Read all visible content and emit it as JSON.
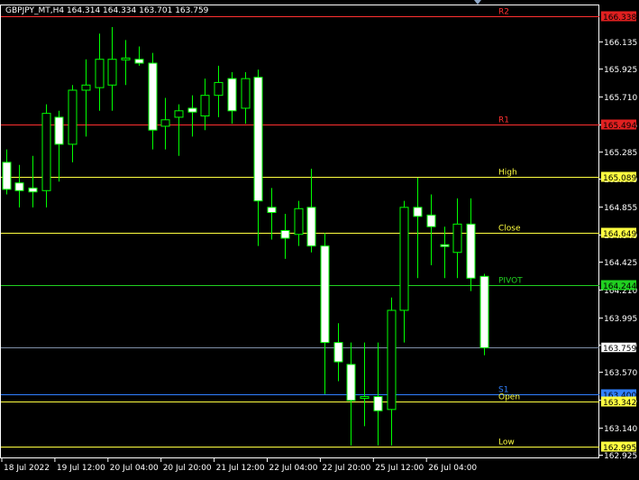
{
  "window": {
    "title": "GBPJPY_MT,H4",
    "ohlc": "164.314 164.334 163.701 163.759"
  },
  "chart_data": {
    "type": "candlestick",
    "symbol": "GBPJPY_MT",
    "timeframe": "H4",
    "y_range": [
      162.9,
      166.4
    ],
    "y_ticks": [
      "166.135",
      "165.925",
      "165.710",
      "165.495",
      "165.285",
      "165.070",
      "164.855",
      "164.640",
      "164.425",
      "164.210",
      "163.995",
      "163.780",
      "163.570",
      "163.355",
      "163.140",
      "162.925"
    ],
    "x_labels": [
      "18 Jul 2022",
      "19 Jul 12:00",
      "20 Jul 04:00",
      "20 Jul 20:00",
      "21 Jul 12:00",
      "22 Jul 04:00",
      "22 Jul 20:00",
      "25 Jul 12:00",
      "26 Jul 04:00"
    ],
    "candles": [
      {
        "o": 165.2,
        "h": 165.3,
        "l": 164.95,
        "c": 164.99
      },
      {
        "o": 165.04,
        "h": 165.18,
        "l": 164.85,
        "c": 164.98
      },
      {
        "o": 165.0,
        "h": 165.25,
        "l": 164.85,
        "c": 164.97
      },
      {
        "o": 164.98,
        "h": 165.65,
        "l": 164.85,
        "c": 165.58
      },
      {
        "o": 165.55,
        "h": 165.6,
        "l": 165.05,
        "c": 165.34
      },
      {
        "o": 165.34,
        "h": 165.8,
        "l": 165.2,
        "c": 165.76
      },
      {
        "o": 165.76,
        "h": 166.0,
        "l": 165.4,
        "c": 165.8
      },
      {
        "o": 165.78,
        "h": 166.2,
        "l": 165.6,
        "c": 166.0
      },
      {
        "o": 165.8,
        "h": 166.25,
        "l": 165.6,
        "c": 166.0
      },
      {
        "o": 166.0,
        "h": 166.15,
        "l": 165.8,
        "c": 166.01
      },
      {
        "o": 166.0,
        "h": 166.1,
        "l": 165.95,
        "c": 165.97
      },
      {
        "o": 165.97,
        "h": 166.05,
        "l": 165.3,
        "c": 165.45
      },
      {
        "o": 165.48,
        "h": 165.7,
        "l": 165.3,
        "c": 165.53
      },
      {
        "o": 165.55,
        "h": 165.65,
        "l": 165.25,
        "c": 165.6
      },
      {
        "o": 165.62,
        "h": 165.72,
        "l": 165.4,
        "c": 165.59
      },
      {
        "o": 165.56,
        "h": 165.85,
        "l": 165.45,
        "c": 165.72
      },
      {
        "o": 165.72,
        "h": 165.95,
        "l": 165.55,
        "c": 165.82
      },
      {
        "o": 165.85,
        "h": 165.9,
        "l": 165.5,
        "c": 165.6
      },
      {
        "o": 165.62,
        "h": 165.9,
        "l": 165.5,
        "c": 165.85
      },
      {
        "o": 165.86,
        "h": 165.92,
        "l": 164.55,
        "c": 164.9
      },
      {
        "o": 164.85,
        "h": 165.0,
        "l": 164.6,
        "c": 164.81
      },
      {
        "o": 164.67,
        "h": 164.8,
        "l": 164.45,
        "c": 164.61
      },
      {
        "o": 164.64,
        "h": 164.9,
        "l": 164.55,
        "c": 164.84
      },
      {
        "o": 164.85,
        "h": 165.15,
        "l": 164.5,
        "c": 164.55
      },
      {
        "o": 164.55,
        "h": 164.65,
        "l": 163.4,
        "c": 163.8
      },
      {
        "o": 163.8,
        "h": 163.95,
        "l": 163.5,
        "c": 163.65
      },
      {
        "o": 163.63,
        "h": 163.8,
        "l": 163.0,
        "c": 163.35
      },
      {
        "o": 163.37,
        "h": 163.8,
        "l": 163.15,
        "c": 163.38
      },
      {
        "o": 163.38,
        "h": 163.8,
        "l": 163.0,
        "c": 163.27
      },
      {
        "o": 163.28,
        "h": 164.15,
        "l": 163.0,
        "c": 164.05
      },
      {
        "o": 164.05,
        "h": 164.9,
        "l": 163.8,
        "c": 164.85
      },
      {
        "o": 164.85,
        "h": 165.08,
        "l": 164.3,
        "c": 164.78
      },
      {
        "o": 164.79,
        "h": 164.95,
        "l": 164.4,
        "c": 164.7
      },
      {
        "o": 164.56,
        "h": 164.7,
        "l": 164.3,
        "c": 164.55
      },
      {
        "o": 164.5,
        "h": 164.92,
        "l": 164.3,
        "c": 164.72
      },
      {
        "o": 164.72,
        "h": 164.92,
        "l": 164.2,
        "c": 164.3
      },
      {
        "o": 164.314,
        "h": 164.334,
        "l": 163.701,
        "c": 163.759
      }
    ],
    "levels": [
      {
        "name": "R2",
        "value": "166.338",
        "color": "#ff3030",
        "label_color": "#ff3030",
        "box_bg": "#e02020",
        "box_fg": "#000000"
      },
      {
        "name": "R1",
        "value": "165.494",
        "color": "#ff3030",
        "label_color": "#ff3030",
        "box_bg": "#e02020",
        "box_fg": "#000000"
      },
      {
        "name": "High",
        "value": "165.089",
        "color": "#ffff40",
        "label_color": "#ffff40",
        "box_bg": "#ffff40",
        "box_fg": "#000000"
      },
      {
        "name": "Close",
        "value": "164.649",
        "color": "#ffff40",
        "label_color": "#ffff40",
        "box_bg": "#ffff40",
        "box_fg": "#000000"
      },
      {
        "name": "PIVOT",
        "value": "164.244",
        "color": "#20d020",
        "label_color": "#20d020",
        "box_bg": "#20d020",
        "box_fg": "#000000"
      },
      {
        "name": "S1",
        "value": "163.400",
        "color": "#3080ff",
        "label_color": "#3080ff",
        "box_bg": "#3080ff",
        "box_fg": "#000000"
      },
      {
        "name": "Open",
        "value": "163.342",
        "color": "#ffff40",
        "label_color": "#ffff40",
        "box_bg": "#ffff40",
        "box_fg": "#000000"
      },
      {
        "name": "Low",
        "value": "162.995",
        "color": "#ffff40",
        "label_color": "#ffff40",
        "box_bg": "#ffff40",
        "box_fg": "#000000"
      }
    ],
    "current_price": {
      "value": "163.759",
      "line_color": "#8090a8",
      "box_bg": "#ffffff",
      "box_fg": "#000000"
    },
    "colors": {
      "background": "#000000",
      "grid_frame": "#ffffff",
      "bull_body": "#000000",
      "bear_body": "#ffffff",
      "wick": "#00ff00",
      "axis_text": "#ffffff"
    }
  }
}
